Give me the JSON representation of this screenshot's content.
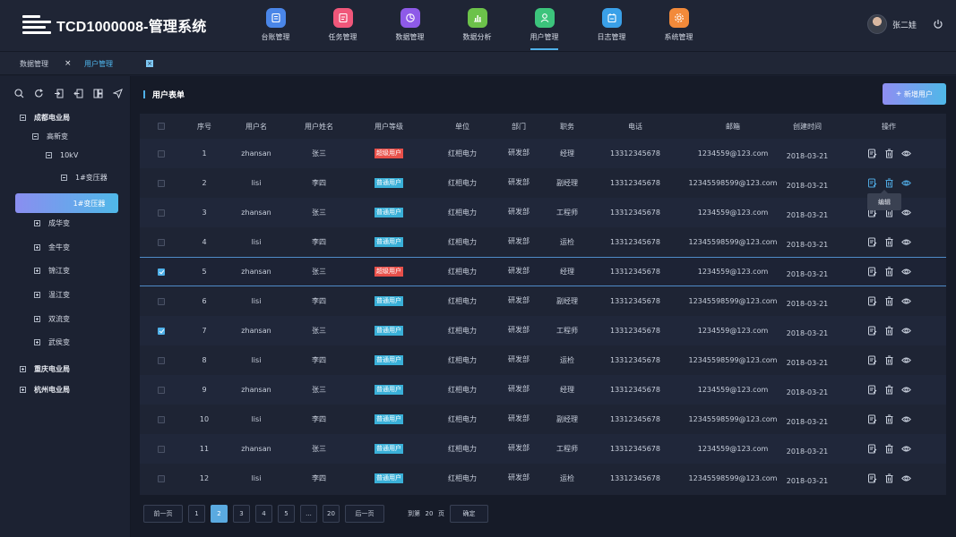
{
  "app": {
    "title": "TCD1000008-管理系统"
  },
  "nav": [
    {
      "label": "台账管理",
      "color": "#4a86e8",
      "icon": "ledger-icon"
    },
    {
      "label": "任务管理",
      "color": "#f0577a",
      "icon": "task-icon"
    },
    {
      "label": "数据管理",
      "color": "#8e5ae8",
      "icon": "data-icon"
    },
    {
      "label": "数据分析",
      "color": "#6cc24a",
      "icon": "chart-icon"
    },
    {
      "label": "用户管理",
      "color": "#3cc47c",
      "icon": "user-icon",
      "active": true
    },
    {
      "label": "日志管理",
      "color": "#3aa0e8",
      "icon": "calendar-icon"
    },
    {
      "label": "系统管理",
      "color": "#f28a3a",
      "icon": "gear-icon"
    }
  ],
  "user": {
    "name": "张二娃"
  },
  "tabs": [
    {
      "label": "数据管理",
      "close": "×"
    },
    {
      "label": "用户管理",
      "close": "×"
    }
  ],
  "tree": {
    "items": [
      {
        "label": "成都电业局",
        "box": "minus",
        "bold": true
      },
      {
        "label": "高新变",
        "box": "minus"
      },
      {
        "label": "10kV",
        "box": "minus"
      },
      {
        "label": "1#变压器",
        "box": "minus"
      },
      {
        "label": "成华变",
        "box": "plus"
      },
      {
        "label": "金牛变",
        "box": "plus"
      },
      {
        "label": "锦江变",
        "box": "plus"
      },
      {
        "label": "温江变",
        "box": "plus"
      },
      {
        "label": "双流变",
        "box": "plus"
      },
      {
        "label": "武侯变",
        "box": "plus"
      },
      {
        "label": "重庆电业局",
        "box": "plus",
        "bold": true
      },
      {
        "label": "杭州电业局",
        "box": "plus",
        "bold": true
      }
    ],
    "selected": "1#变压器"
  },
  "main": {
    "title": "用户表单",
    "add_button": "新增用户",
    "add_plus": "+",
    "tooltip": "编辑"
  },
  "table": {
    "columns": [
      "序号",
      "用户名",
      "用户姓名",
      "用户等级",
      "单位",
      "部门",
      "职务",
      "电话",
      "邮箱",
      "创建时间",
      "操作"
    ],
    "rows": [
      {
        "no": "1",
        "username": "zhansan",
        "name": "张三",
        "level": "超级用户",
        "level_type": "super",
        "unit": "红相电力",
        "dept": "研发部",
        "title": "经理",
        "phone": "13312345678",
        "email": "1234559@123.com",
        "created": "2018-03-21",
        "checked": false
      },
      {
        "no": "2",
        "username": "lisi",
        "name": "李四",
        "level": "普通用户",
        "level_type": "normal",
        "unit": "红相电力",
        "dept": "研发部",
        "title": "副经理",
        "phone": "13312345678",
        "email": "12345598599@123.com",
        "created": "2018-03-21",
        "checked": false
      },
      {
        "no": "3",
        "username": "zhansan",
        "name": "张三",
        "level": "普通用户",
        "level_type": "normal",
        "unit": "红相电力",
        "dept": "研发部",
        "title": "工程师",
        "phone": "13312345678",
        "email": "1234559@123.com",
        "created": "2018-03-21",
        "checked": false
      },
      {
        "no": "4",
        "username": "lisi",
        "name": "李四",
        "level": "普通用户",
        "level_type": "normal",
        "unit": "红相电力",
        "dept": "研发部",
        "title": "运检",
        "phone": "13312345678",
        "email": "12345598599@123.com",
        "created": "2018-03-21",
        "checked": false
      },
      {
        "no": "5",
        "username": "zhansan",
        "name": "张三",
        "level": "超级用户",
        "level_type": "super",
        "unit": "红相电力",
        "dept": "研发部",
        "title": "经理",
        "phone": "13312345678",
        "email": "1234559@123.com",
        "created": "2018-03-21",
        "checked": true
      },
      {
        "no": "6",
        "username": "lisi",
        "name": "李四",
        "level": "普通用户",
        "level_type": "normal",
        "unit": "红相电力",
        "dept": "研发部",
        "title": "副经理",
        "phone": "13312345678",
        "email": "12345598599@123.com",
        "created": "2018-03-21",
        "checked": false
      },
      {
        "no": "7",
        "username": "zhansan",
        "name": "张三",
        "level": "普通用户",
        "level_type": "normal",
        "unit": "红相电力",
        "dept": "研发部",
        "title": "工程师",
        "phone": "13312345678",
        "email": "1234559@123.com",
        "created": "2018-03-21",
        "checked": true
      },
      {
        "no": "8",
        "username": "lisi",
        "name": "李四",
        "level": "普通用户",
        "level_type": "normal",
        "unit": "红相电力",
        "dept": "研发部",
        "title": "运检",
        "phone": "13312345678",
        "email": "12345598599@123.com",
        "created": "2018-03-21",
        "checked": false
      },
      {
        "no": "9",
        "username": "zhansan",
        "name": "张三",
        "level": "普通用户",
        "level_type": "normal",
        "unit": "红相电力",
        "dept": "研发部",
        "title": "经理",
        "phone": "13312345678",
        "email": "1234559@123.com",
        "created": "2018-03-21",
        "checked": false
      },
      {
        "no": "10",
        "username": "lisi",
        "name": "李四",
        "level": "普通用户",
        "level_type": "normal",
        "unit": "红相电力",
        "dept": "研发部",
        "title": "副经理",
        "phone": "13312345678",
        "email": "12345598599@123.com",
        "created": "2018-03-21",
        "checked": false
      },
      {
        "no": "11",
        "username": "zhansan",
        "name": "张三",
        "level": "普通用户",
        "level_type": "normal",
        "unit": "红相电力",
        "dept": "研发部",
        "title": "工程师",
        "phone": "13312345678",
        "email": "1234559@123.com",
        "created": "2018-03-21",
        "checked": false
      },
      {
        "no": "12",
        "username": "lisi",
        "name": "李四",
        "level": "普通用户",
        "level_type": "normal",
        "unit": "红相电力",
        "dept": "研发部",
        "title": "运检",
        "phone": "13312345678",
        "email": "12345598599@123.com",
        "created": "2018-03-21",
        "checked": false
      }
    ]
  },
  "pager": {
    "prev": "前一页",
    "next": "后一页",
    "pages": [
      "1",
      "2",
      "3",
      "4",
      "5",
      "...",
      "20"
    ],
    "current": "2",
    "goto_prefix": "到第",
    "goto_value": "20",
    "goto_suffix": "页",
    "confirm": "确定"
  },
  "colors": {
    "accent": "#4fb0e8",
    "super_badge": "#e8504a",
    "normal_badge": "#3ab0d8"
  }
}
